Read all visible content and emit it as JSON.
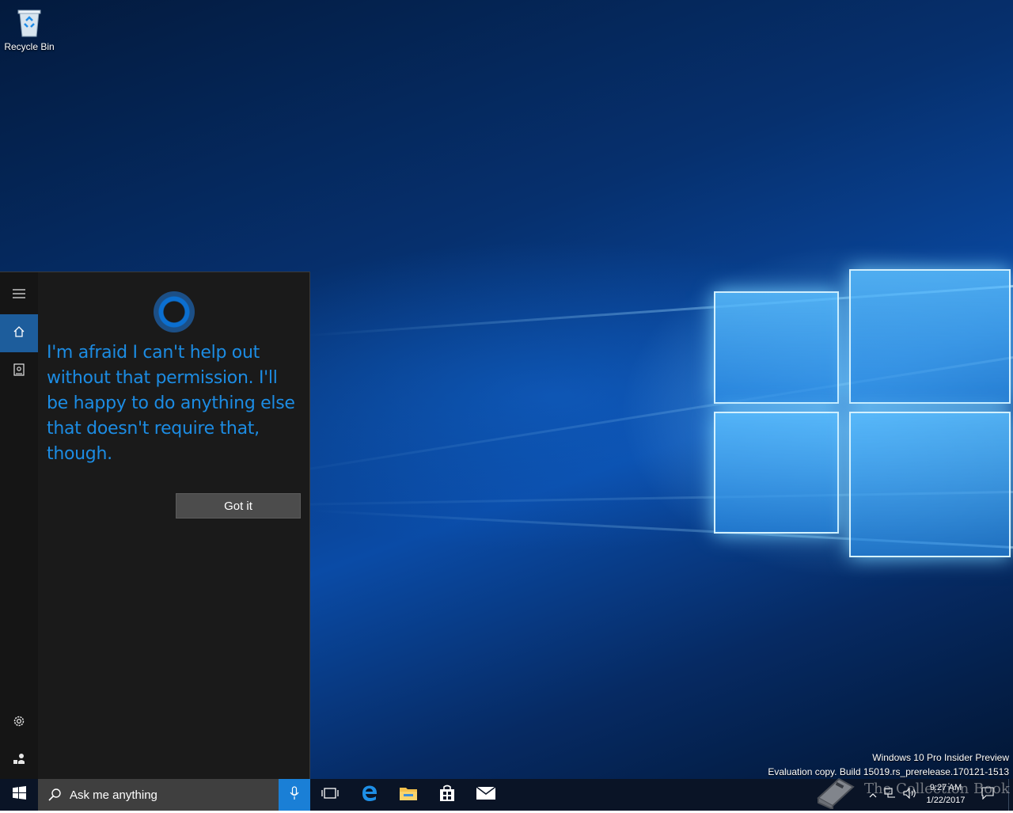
{
  "desktop": {
    "recycle_bin_label": "Recycle Bin",
    "watermark_line1": "Windows 10 Pro Insider Preview",
    "watermark_line2": "Evaluation copy. Build 15019.rs_prerelease.170121-1513"
  },
  "cortana": {
    "message": "I'm afraid I can't help out without that permission. I'll be happy to do anything else that doesn't require that, though.",
    "got_it_label": "Got it",
    "rail": {
      "menu_icon": "hamburger-icon",
      "home_icon": "home-icon",
      "notebook_icon": "notebook-icon",
      "settings_icon": "gear-icon",
      "feedback_icon": "feedback-icon"
    }
  },
  "taskbar": {
    "search_placeholder": "Ask me anything",
    "clock_time": "9:27 AM",
    "clock_date": "1/22/2017",
    "pinned": [
      "task-view",
      "edge",
      "file-explorer",
      "store",
      "mail"
    ],
    "overlay_text": "The Collection Book"
  },
  "colors": {
    "accent": "#1a7fd6",
    "cortana_text": "#1c8ce3",
    "panel_bg": "#1a1a1a",
    "taskbar_bg": "#0a1426"
  }
}
